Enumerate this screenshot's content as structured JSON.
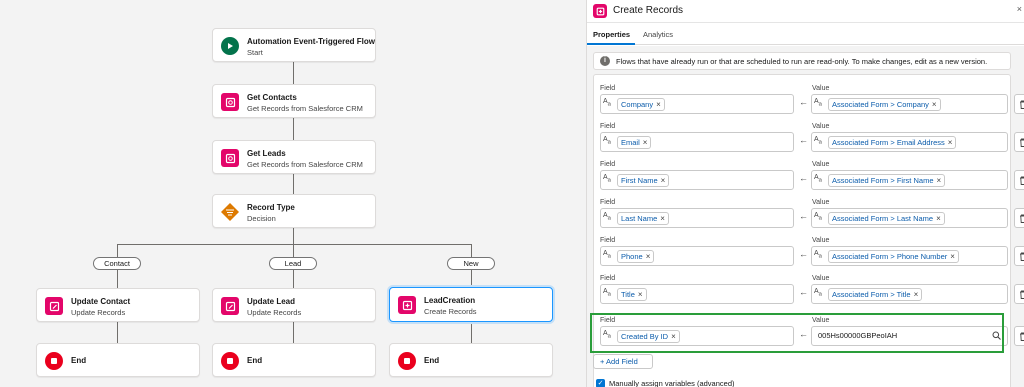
{
  "canvas": {
    "nodes": [
      {
        "title": "Automation Event-Triggered Flow",
        "subtitle": "Start",
        "icon": "play-icon",
        "color": "#03734b"
      },
      {
        "title": "Get Contacts",
        "subtitle": "Get Records from Salesforce CRM",
        "icon": "get-records-icon",
        "color": "#e3066a"
      },
      {
        "title": "Get Leads",
        "subtitle": "Get Records from Salesforce CRM",
        "icon": "get-records-icon",
        "color": "#e3066a"
      },
      {
        "title": "Record Type",
        "subtitle": "Decision",
        "icon": "decision-icon",
        "color": "#dd7a01"
      },
      {
        "title": "Update Contact",
        "subtitle": "Update Records",
        "icon": "update-records-icon",
        "color": "#e3066a"
      },
      {
        "title": "Update Lead",
        "subtitle": "Update Records",
        "icon": "update-records-icon",
        "color": "#e3066a"
      },
      {
        "title": "LeadCreation",
        "subtitle": "Create Records",
        "icon": "create-records-icon",
        "color": "#e3066a"
      },
      {
        "title": "End",
        "icon": "end-icon",
        "color": "#ea001e"
      },
      {
        "title": "End",
        "icon": "end-icon",
        "color": "#ea001e"
      },
      {
        "title": "End",
        "icon": "end-icon",
        "color": "#ea001e"
      }
    ],
    "branches": [
      "Contact",
      "Lead",
      "New"
    ]
  },
  "panel": {
    "title": "Create Records",
    "close": "×",
    "tabs": [
      {
        "label": "Properties"
      },
      {
        "label": "Analytics"
      }
    ],
    "notice": "Flows that have already run or that are scheduled to run are read-only. To make changes, edit as a new version.",
    "field_label": "Field",
    "value_label": "Value",
    "rows": [
      {
        "field": "Company",
        "value": "Associated Form > Company"
      },
      {
        "field": "Email",
        "value": "Associated Form > Email Address"
      },
      {
        "field": "First Name",
        "value": "Associated Form > First Name"
      },
      {
        "field": "Last Name",
        "value": "Associated Form > Last Name"
      },
      {
        "field": "Phone",
        "value": "Associated Form > Phone Number"
      },
      {
        "field": "Title",
        "value": "Associated Form > Title"
      },
      {
        "field": "Created By ID",
        "value": "005Hs00000GBPeoIAH"
      }
    ],
    "add_field": "+ Add Field",
    "manual_assign": "Manually assign variables (advanced)"
  }
}
